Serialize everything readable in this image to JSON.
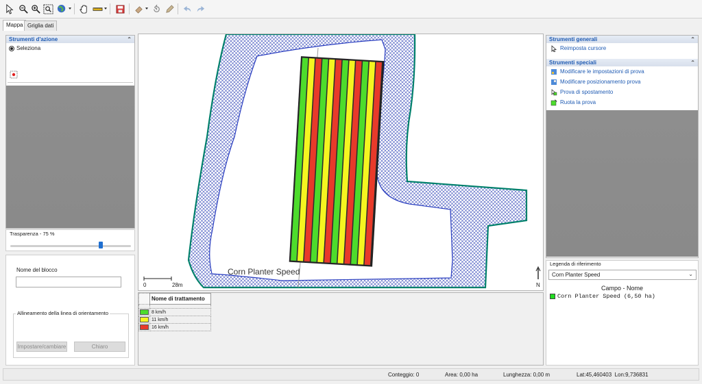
{
  "tabs": [
    {
      "label": "Mappa"
    },
    {
      "label": "Griglia dati"
    }
  ],
  "left_panel": {
    "section_title": "Strumenti d'azione",
    "radio_label": "Seleziona",
    "transparency_label": "Trasparenza - 75 %",
    "transparency_value": 0.75,
    "block_name_label": "Nome del blocco",
    "block_name_value": "",
    "orientation_group_label": "Allineamento della linea di orientamento",
    "set_button": "Impostare/cambiare",
    "clear_button": "Chiaro"
  },
  "map": {
    "trial_label": "Corn Planter Speed",
    "scale_zero": "0",
    "scale_value": "28m",
    "north_label": "N",
    "colors": {
      "green": "#4ddc2c",
      "yellow": "#f5f520",
      "red": "#e83a2a",
      "hatch": "#3a4dbb",
      "boundary": "#00806b"
    }
  },
  "treatment_table": {
    "header": "Nome di trattamento",
    "rows": [
      {
        "color": "#4ddc2c",
        "label": "8 km/h"
      },
      {
        "color": "#f5f520",
        "label": "11 km/h"
      },
      {
        "color": "#e83a2a",
        "label": "16 km/h"
      }
    ]
  },
  "right_panel": {
    "general_title": "Strumenti generali",
    "general_items": [
      {
        "label": "Reimposta cursore",
        "icon": "cursor-icon"
      }
    ],
    "special_title": "Strumenti speciali",
    "special_items": [
      {
        "label": "Modificare le impostazioni di prova",
        "icon": "trial-settings-icon"
      },
      {
        "label": "Modificare posizionamento prova",
        "icon": "trial-position-icon"
      },
      {
        "label": "Prova di spostamento",
        "icon": "move-trial-icon"
      },
      {
        "label": "Ruota la prova",
        "icon": "rotate-trial-icon"
      }
    ],
    "legend_title": "Legenda di riferimento",
    "legend_select": "Corn Planter Speed",
    "legend_heading": "Campo - Nome",
    "legend_entry": "Corn Planter Speed (6,50 ha)",
    "legend_color": "#22dd22"
  },
  "status_bar": {
    "count": "Conteggio: 0",
    "area": "Area: 0,00 ha",
    "length": "Lunghezza: 0,00 m",
    "coords": "Lat:45,460403  Lon:9,736831"
  }
}
